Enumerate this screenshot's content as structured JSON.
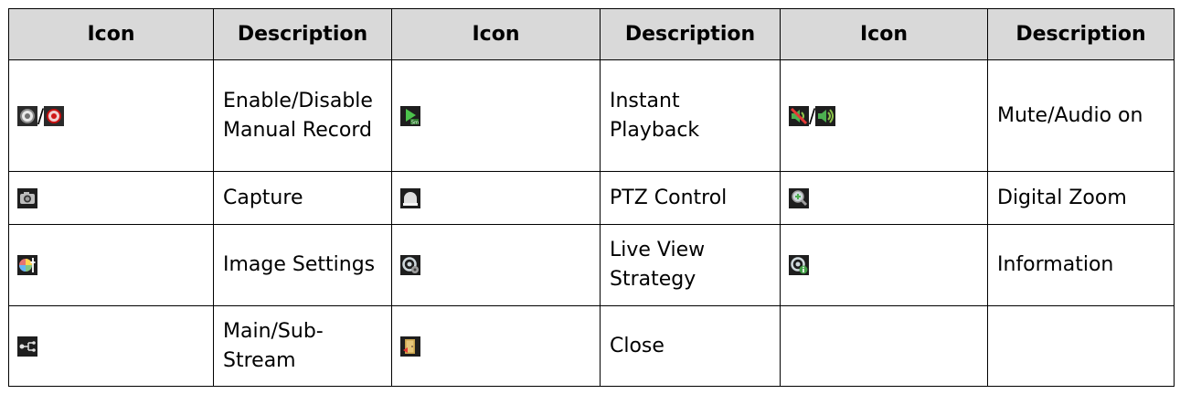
{
  "headers": [
    "Icon",
    "Description",
    "Icon",
    "Description",
    "Icon",
    "Description"
  ],
  "rows": [
    [
      {
        "icons": [
          "record-off-icon",
          "record-on-icon"
        ],
        "desc": "Enable/Disable Manual Record"
      },
      {
        "icons": [
          "instant-playback-icon"
        ],
        "desc": "Instant Playback"
      },
      {
        "icons": [
          "mute-icon",
          "audio-on-icon"
        ],
        "desc": "Mute/Audio on"
      }
    ],
    [
      {
        "icons": [
          "capture-icon"
        ],
        "desc": "Capture"
      },
      {
        "icons": [
          "ptz-dome-icon"
        ],
        "desc": "PTZ Control"
      },
      {
        "icons": [
          "digital-zoom-icon"
        ],
        "desc": "Digital Zoom"
      }
    ],
    [
      {
        "icons": [
          "image-settings-icon"
        ],
        "desc": "Image Settings"
      },
      {
        "icons": [
          "live-view-strategy-icon"
        ],
        "desc": "Live View Strategy"
      },
      {
        "icons": [
          "information-icon"
        ],
        "desc": "Information"
      }
    ],
    [
      {
        "icons": [
          "stream-switch-icon"
        ],
        "desc": "Main/Sub-Stream"
      },
      {
        "icons": [
          "close-icon"
        ],
        "desc": "Close"
      },
      {
        "icons": [],
        "desc": ""
      }
    ]
  ],
  "separator": "/"
}
